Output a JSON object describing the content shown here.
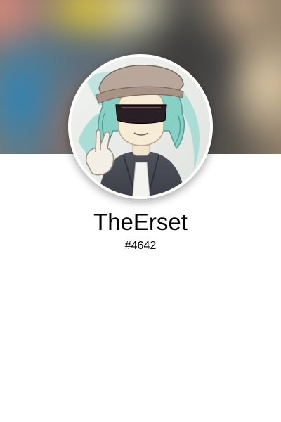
{
  "profile": {
    "username": "TheErset",
    "discriminator": "#4642"
  },
  "banner": {
    "style": "blurred-image"
  },
  "avatar": {
    "description_icon": "user-avatar-icon"
  },
  "colors": {
    "background": "#ffffff",
    "avatar_border": "#ffffff",
    "text": "#000000"
  }
}
